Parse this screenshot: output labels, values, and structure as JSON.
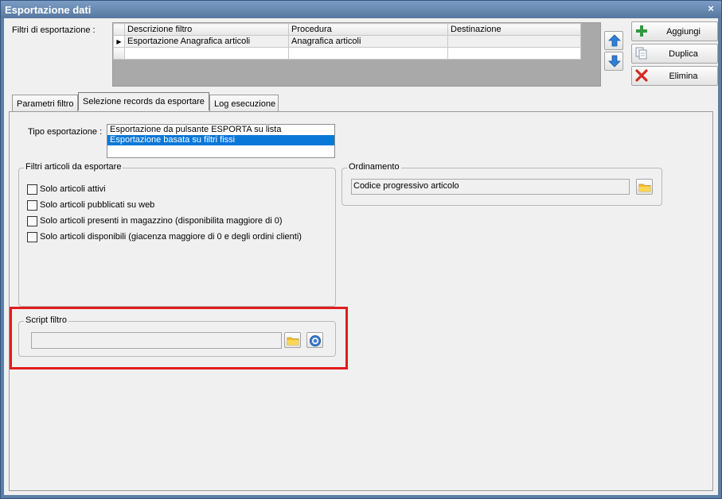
{
  "window": {
    "title": "Esportazione dati",
    "close_glyph": "×"
  },
  "filters": {
    "label": "Filtri di esportazione :",
    "columns": [
      "Descrizione filtro",
      "Procedura",
      "Destinazione"
    ],
    "rows": [
      {
        "indicator": "▶",
        "cells": [
          "Esportazione Anagrafica articoli",
          "Anagrafica articoli",
          ""
        ]
      },
      {
        "indicator": "",
        "cells": [
          "",
          "",
          ""
        ]
      }
    ]
  },
  "move_up_icon": "arrow-up-icon",
  "move_down_icon": "arrow-down-icon",
  "buttons": {
    "add": {
      "label": "Aggiungi",
      "icon": "plus-icon",
      "color": "#2e9a3c"
    },
    "duplicate": {
      "label": "Duplica",
      "icon": "copy-icon"
    },
    "delete": {
      "label": "Elimina",
      "icon": "x-icon",
      "color": "#d62a1f"
    }
  },
  "tabs": [
    {
      "label": "Parametri filtro",
      "active": false
    },
    {
      "label": "Selezione records da esportare",
      "active": true
    },
    {
      "label": "Log esecuzione",
      "active": false
    }
  ],
  "export_type": {
    "label": "Tipo esportazione :",
    "options": [
      "Esportazione da pulsante ESPORTA su lista",
      "Esportazione basata su filtri fissi"
    ],
    "selected_index": 1
  },
  "article_filters": {
    "title": "Filtri articoli da esportare",
    "checkboxes": [
      {
        "label": "Solo articoli attivi",
        "checked": false
      },
      {
        "label": "Solo articoli pubblicati su web",
        "checked": false
      },
      {
        "label": "Solo articoli presenti in magazzino (disponibilita maggiore di 0)",
        "checked": false
      },
      {
        "label": "Solo articoli disponibili (giacenza maggiore di 0 e degli ordini clienti)",
        "checked": false
      }
    ]
  },
  "ordering": {
    "title": "Ordinamento",
    "value": "Codice progressivo articolo",
    "browse_icon": "folder-icon"
  },
  "script": {
    "title": "Script filtro",
    "value": "",
    "browse_icon": "folder-icon",
    "help_icon": "help-icon"
  },
  "colors": {
    "accent": "#0a78d7",
    "highlight": "#e11c1c",
    "titlebar": "#5c7fa8"
  }
}
